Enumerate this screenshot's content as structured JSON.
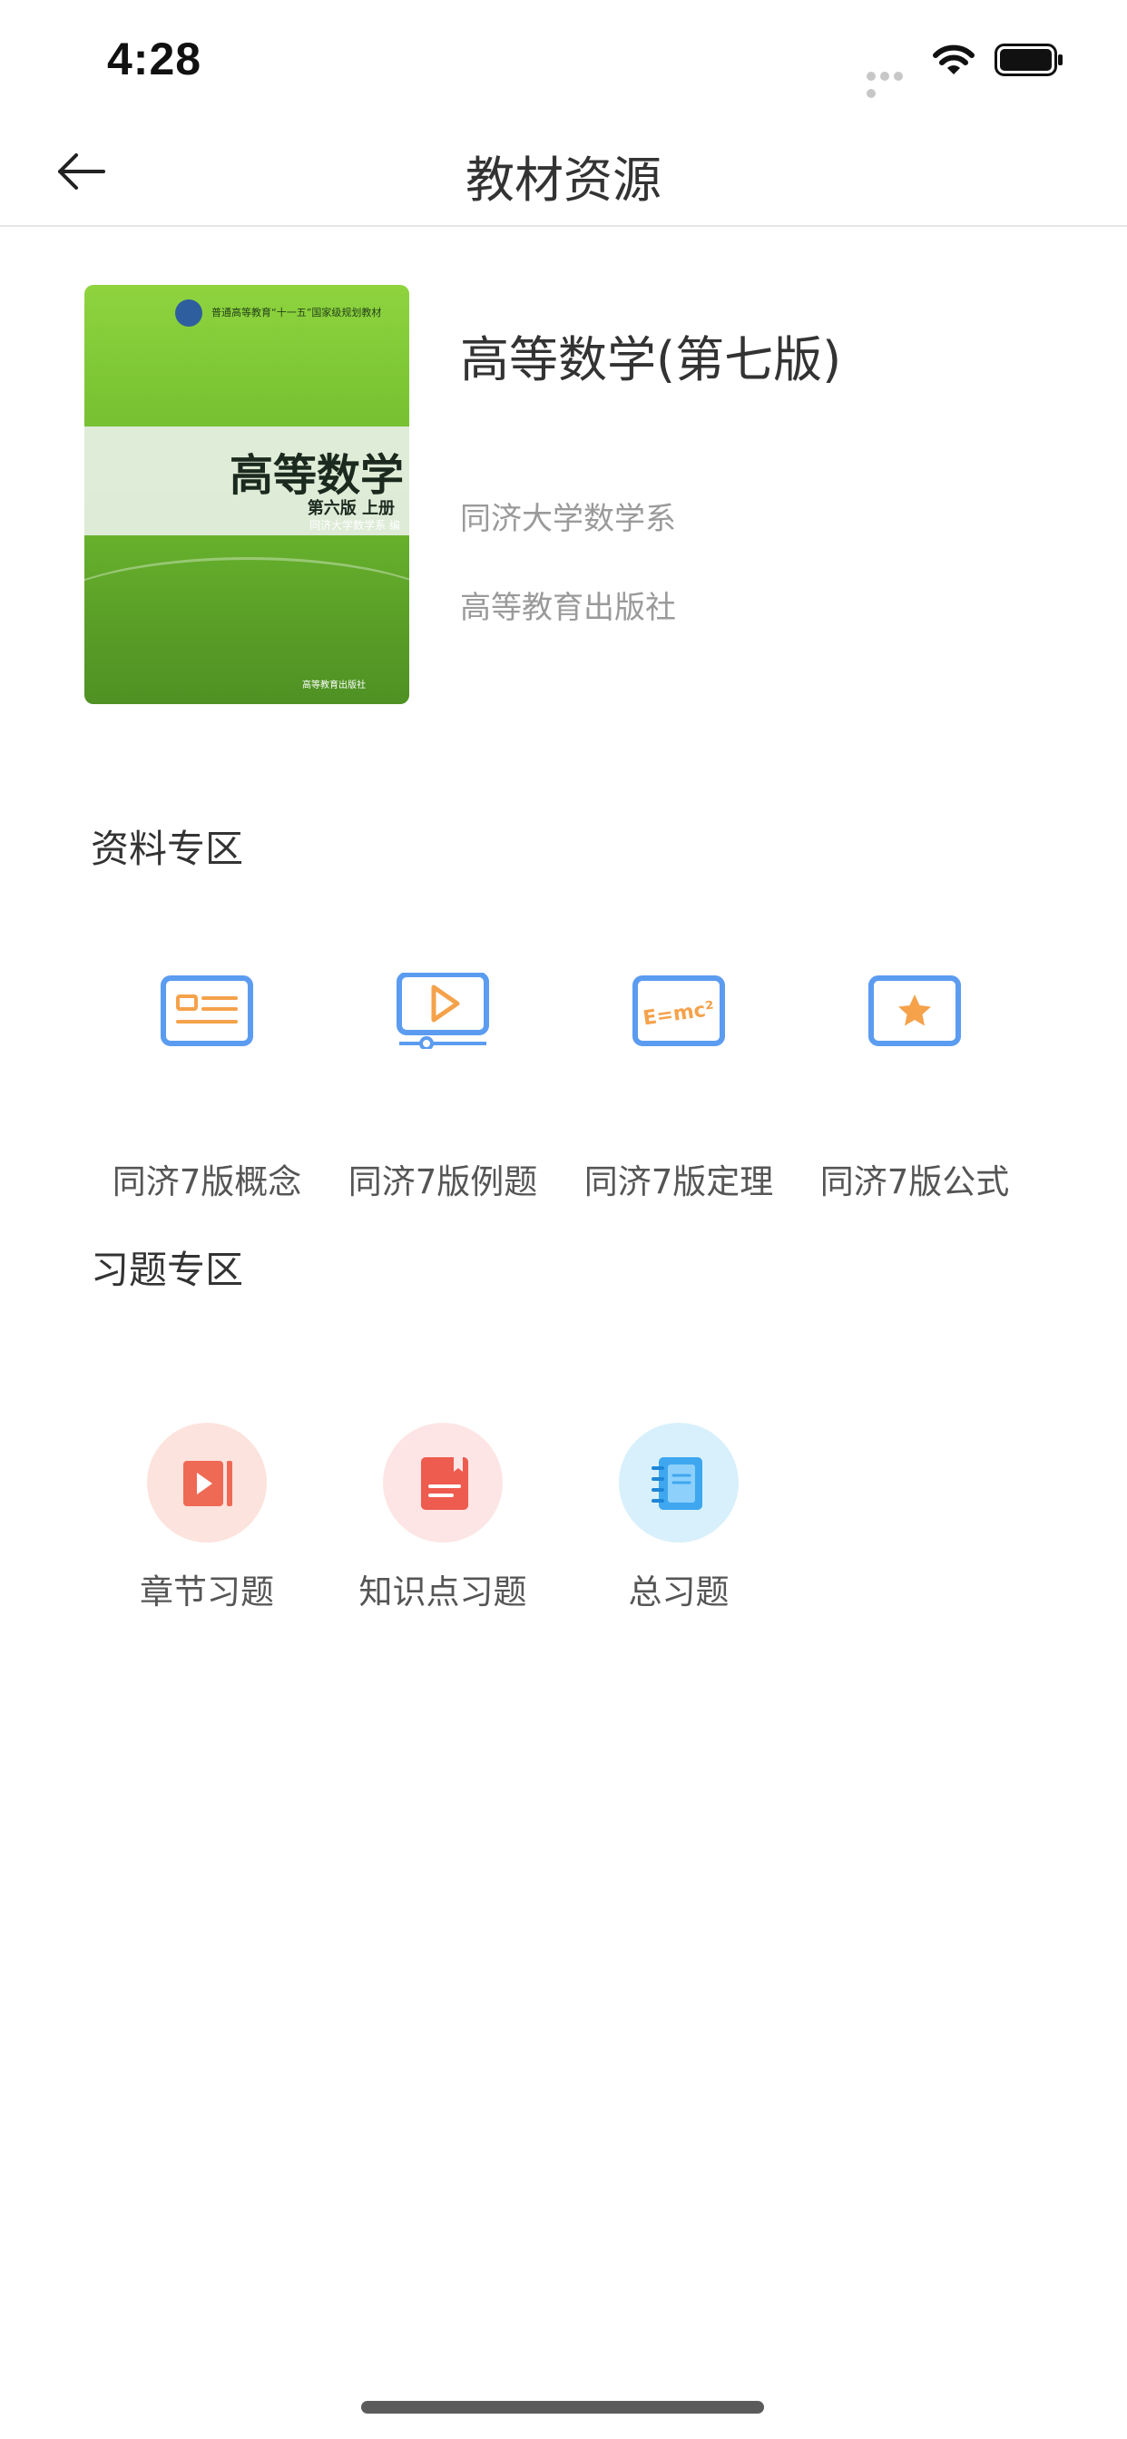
{
  "status_bar": {
    "time": "4:28"
  },
  "nav": {
    "title": "教材资源"
  },
  "book": {
    "cover": {
      "series": "普通高等教育“十一五”国家级规划教材",
      "title": "高等数学",
      "edition": "第六版 上册",
      "author": "同济大学数学系 编",
      "publisher": "高等教育出版社"
    },
    "title": "高等数学(第七版)",
    "author": "同济大学数学系",
    "publisher": "高等教育出版社"
  },
  "materials": {
    "title": "资料专区",
    "items": [
      {
        "label": "同济7版概念",
        "icon": "concept-card-icon"
      },
      {
        "label": "同济7版例题",
        "icon": "video-play-icon"
      },
      {
        "label": "同济7版定理",
        "icon": "formula-icon",
        "icon_text": "E=mc²"
      },
      {
        "label": "同济7版公式",
        "icon": "star-card-icon"
      }
    ]
  },
  "exercises": {
    "title": "习题专区",
    "items": [
      {
        "label": "章节习题",
        "icon": "chapter-video-icon"
      },
      {
        "label": "知识点习题",
        "icon": "book-icon"
      },
      {
        "label": "总习题",
        "icon": "notebook-icon"
      }
    ]
  },
  "colors": {
    "accent_blue": "#5b9cf0",
    "accent_orange": "#f5a24b",
    "red": "#ee5b4f",
    "light_blue": "#3fa7ef"
  }
}
